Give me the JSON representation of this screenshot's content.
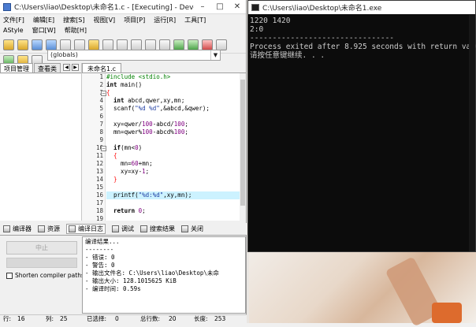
{
  "ide": {
    "title": "C:\\Users\\liao\\Desktop\\未命名1.c - [Executing] - Dev-C++...",
    "menu": [
      "文件[F]",
      "编辑[E]",
      "搜索[S]",
      "视图[V]",
      "项目[P]",
      "运行[R]",
      "工具[T]",
      "AStyle",
      "窗口[W]",
      "帮助[H]"
    ],
    "scope_combo": "(globals)",
    "left_tabs": [
      "项目管理",
      "查看类"
    ],
    "editor_tab": "未命名1.c",
    "line_numbers": [
      "1",
      "2",
      "3",
      "4",
      "5",
      "6",
      "7",
      "8",
      "9",
      "10",
      "11",
      "12",
      "13",
      "14",
      "15",
      "16",
      "17",
      "18",
      "19",
      "20"
    ],
    "code": {
      "l1": "#include <stdio.h>",
      "l2a": "int",
      "l2b": " main()",
      "l3": "{",
      "l4a": "  int",
      "l4b": " abcd,qwer,xy,mn;",
      "l5a": "  scanf(",
      "l5b": "\"%d %d\"",
      "l5c": ",&abcd,&qwer);",
      "l7a": "  xy=qwer/",
      "l7b": "100",
      "l7c": "-abcd/",
      "l7d": "100",
      "l7e": ";",
      "l8a": "  mn=qwer%",
      "l8b": "100",
      "l8c": "-abcd%",
      "l8d": "100",
      "l8e": ";",
      "l10a": "  if",
      "l10b": "(mn<",
      "l10c": "0",
      "l10d": ")",
      "l11": "  {",
      "l12a": "    mn=",
      "l12b": "60",
      "l12c": "+mn;",
      "l13a": "    xy=xy-",
      "l13b": "1",
      "l13c": ";",
      "l14": "  }",
      "l16a": "  printf(",
      "l16b": "\"%d:%d\"",
      "l16c": ",xy,mn);",
      "l18a": "  return",
      "l18b": " 0",
      "l18c": ";",
      "l20": "}"
    },
    "bottom_tabs": [
      "编译器",
      "资源",
      "编译日志",
      "调试",
      "搜索结果",
      "关闭"
    ],
    "abort_label": "中止",
    "shorten_label": "Shorten compiler paths",
    "log_lines": [
      "编译结果...",
      "--------",
      "- 错误: 0",
      "- 警告: 0",
      "- 输出文件名: C:\\Users\\liao\\Desktop\\未命",
      "- 输出大小: 128.1015625 KiB",
      "- 编译时间: 0.59s"
    ],
    "status": {
      "row_label": "行:",
      "row_value": "16",
      "col_label": "列:",
      "col_value": "25",
      "sel_label": "已选择:",
      "sel_value": "0",
      "total_label": "总行数:",
      "total_value": "20",
      "len_label": "长度:",
      "len_value": "253"
    }
  },
  "console": {
    "title": "C:\\Users\\liao\\Desktop\\未命名1.exe",
    "lines": [
      "1220 1420",
      "2:0",
      "--------------------------------",
      "Process exited after 8.925 seconds with return value 0",
      "请按任意键继续. . ."
    ]
  }
}
